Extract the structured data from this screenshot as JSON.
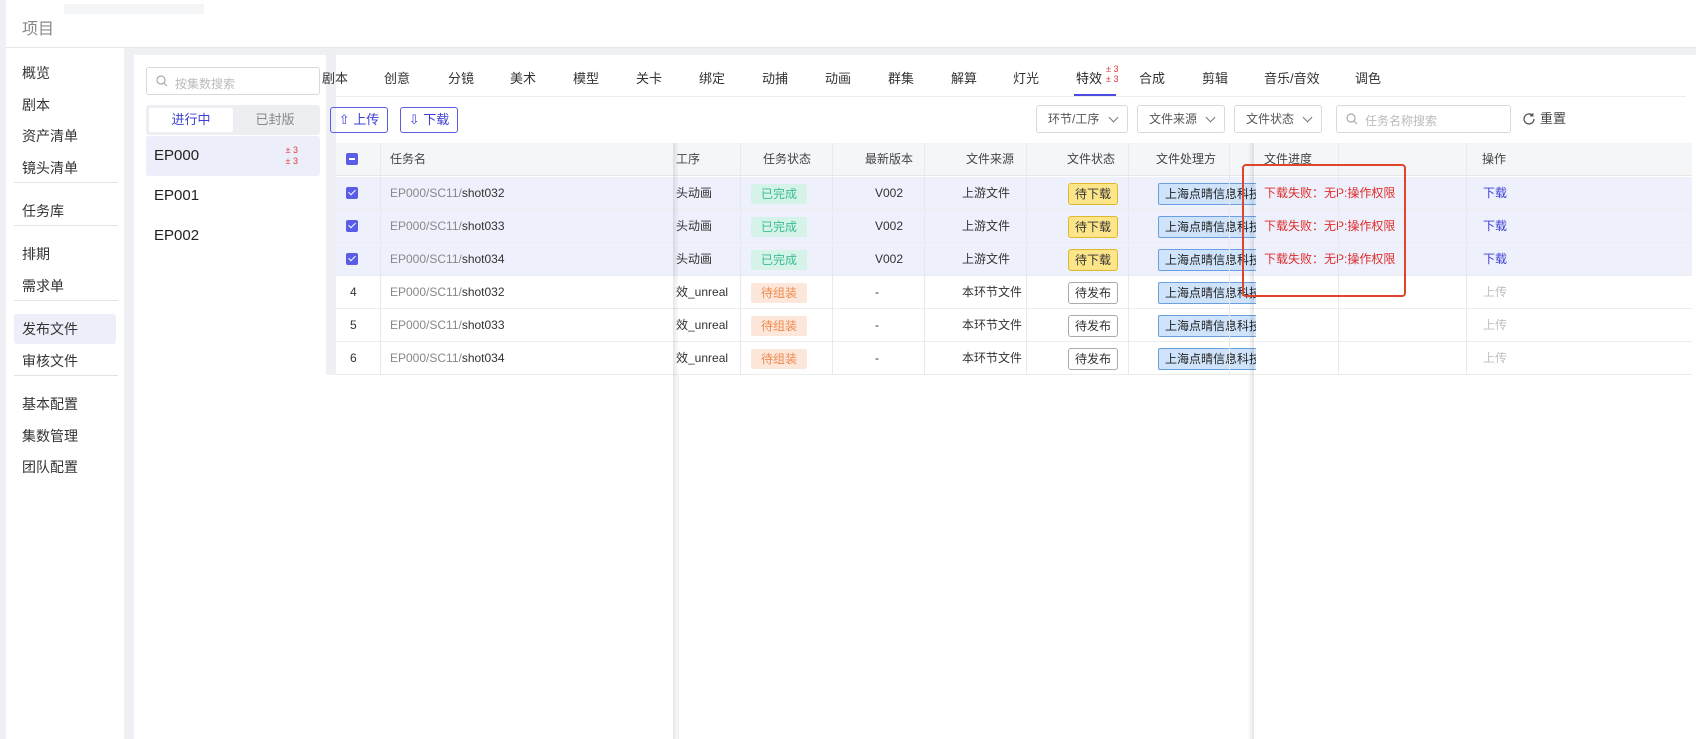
{
  "header": {
    "title": "项目"
  },
  "nav": {
    "items": [
      {
        "label": "概览"
      },
      {
        "label": "剧本"
      },
      {
        "label": "资产清单"
      },
      {
        "label": "镜头清单"
      },
      {
        "label": "任务库"
      },
      {
        "label": "排期"
      },
      {
        "label": "需求单"
      },
      {
        "label": "发布文件"
      },
      {
        "label": "审核文件"
      },
      {
        "label": "基本配置"
      },
      {
        "label": "集数管理"
      },
      {
        "label": "团队配置"
      }
    ],
    "active": "发布文件"
  },
  "episodes": {
    "search_placeholder": "按集数搜索",
    "segments": [
      "进行中",
      "已封版"
    ],
    "items": [
      {
        "label": "EP000",
        "badge_up": "± 3",
        "badge_down": "± 3"
      },
      {
        "label": "EP001"
      },
      {
        "label": "EP002"
      }
    ]
  },
  "tabs": {
    "items": [
      "剧本",
      "创意",
      "分镜",
      "美术",
      "模型",
      "关卡",
      "绑定",
      "动捕",
      "动画",
      "群集",
      "解算",
      "灯光",
      "特效",
      "合成",
      "剪辑",
      "音乐/音效",
      "调色"
    ],
    "active": "特效",
    "active_badge_up": "± 3",
    "active_badge_down": "± 3"
  },
  "toolbar": {
    "upload_label": "上传",
    "download_label": "下载",
    "filter_stage": "环节/工序",
    "filter_source": "文件来源",
    "filter_status": "文件状态",
    "search_placeholder": "任务名称搜索",
    "reset_label": "重置"
  },
  "table": {
    "columns": {
      "task": "任务名",
      "process": "工序",
      "task_status": "任务状态",
      "version": "最新版本",
      "source": "文件来源",
      "file_status": "文件状态",
      "handler": "文件处理方",
      "progress": "文件进度",
      "action": "操作"
    },
    "rows": [
      {
        "index": "",
        "selected": true,
        "prefix": "EP000/SC11/",
        "shot": "shot032",
        "process": "头动画",
        "task_status": "已完成",
        "status_kind": "done",
        "version": "V002",
        "source": "上游文件",
        "file_status": "待下载",
        "file_kind": "yellow",
        "handler": "上海点晴信息科技有限公司",
        "progress": "下载失败：无P:操作权限",
        "action": "下载",
        "action_enabled": true
      },
      {
        "index": "",
        "selected": true,
        "prefix": "EP000/SC11/",
        "shot": "shot033",
        "process": "头动画",
        "task_status": "已完成",
        "status_kind": "done",
        "version": "V002",
        "source": "上游文件",
        "file_status": "待下载",
        "file_kind": "yellow",
        "handler": "上海点晴信息科技有限公司",
        "progress": "下载失败：无P:操作权限",
        "action": "下载",
        "action_enabled": true
      },
      {
        "index": "",
        "selected": true,
        "prefix": "EP000/SC11/",
        "shot": "shot034",
        "process": "头动画",
        "task_status": "已完成",
        "status_kind": "done",
        "version": "V002",
        "source": "上游文件",
        "file_status": "待下载",
        "file_kind": "yellow",
        "handler": "上海点晴信息科技有限公司",
        "progress": "下载失败：无P:操作权限",
        "action": "下载",
        "action_enabled": true
      },
      {
        "index": "4",
        "selected": false,
        "prefix": "EP000/SC11/",
        "shot": "shot032",
        "process": "效_unreal",
        "task_status": "待组装",
        "status_kind": "pend",
        "version": "-",
        "source": "本环节文件",
        "file_status": "待发布",
        "file_kind": "white",
        "handler": "上海点晴信息科技有限公司",
        "progress": "",
        "action": "上传",
        "action_enabled": false
      },
      {
        "index": "5",
        "selected": false,
        "prefix": "EP000/SC11/",
        "shot": "shot033",
        "process": "效_unreal",
        "task_status": "待组装",
        "status_kind": "pend",
        "version": "-",
        "source": "本环节文件",
        "file_status": "待发布",
        "file_kind": "white",
        "handler": "上海点晴信息科技有限公司",
        "progress": "",
        "action": "上传",
        "action_enabled": false
      },
      {
        "index": "6",
        "selected": false,
        "prefix": "EP000/SC11/",
        "shot": "shot034",
        "process": "效_unreal",
        "task_status": "待组装",
        "status_kind": "pend",
        "version": "-",
        "source": "本环节文件",
        "file_status": "待发布",
        "file_kind": "white",
        "handler": "上海点晴信息科技有限公司",
        "progress": "",
        "action": "上传",
        "action_enabled": false
      }
    ]
  },
  "colors": {
    "accent": "#4a4de0",
    "error": "#e02c2c",
    "highlight_box": "#e0442c"
  }
}
